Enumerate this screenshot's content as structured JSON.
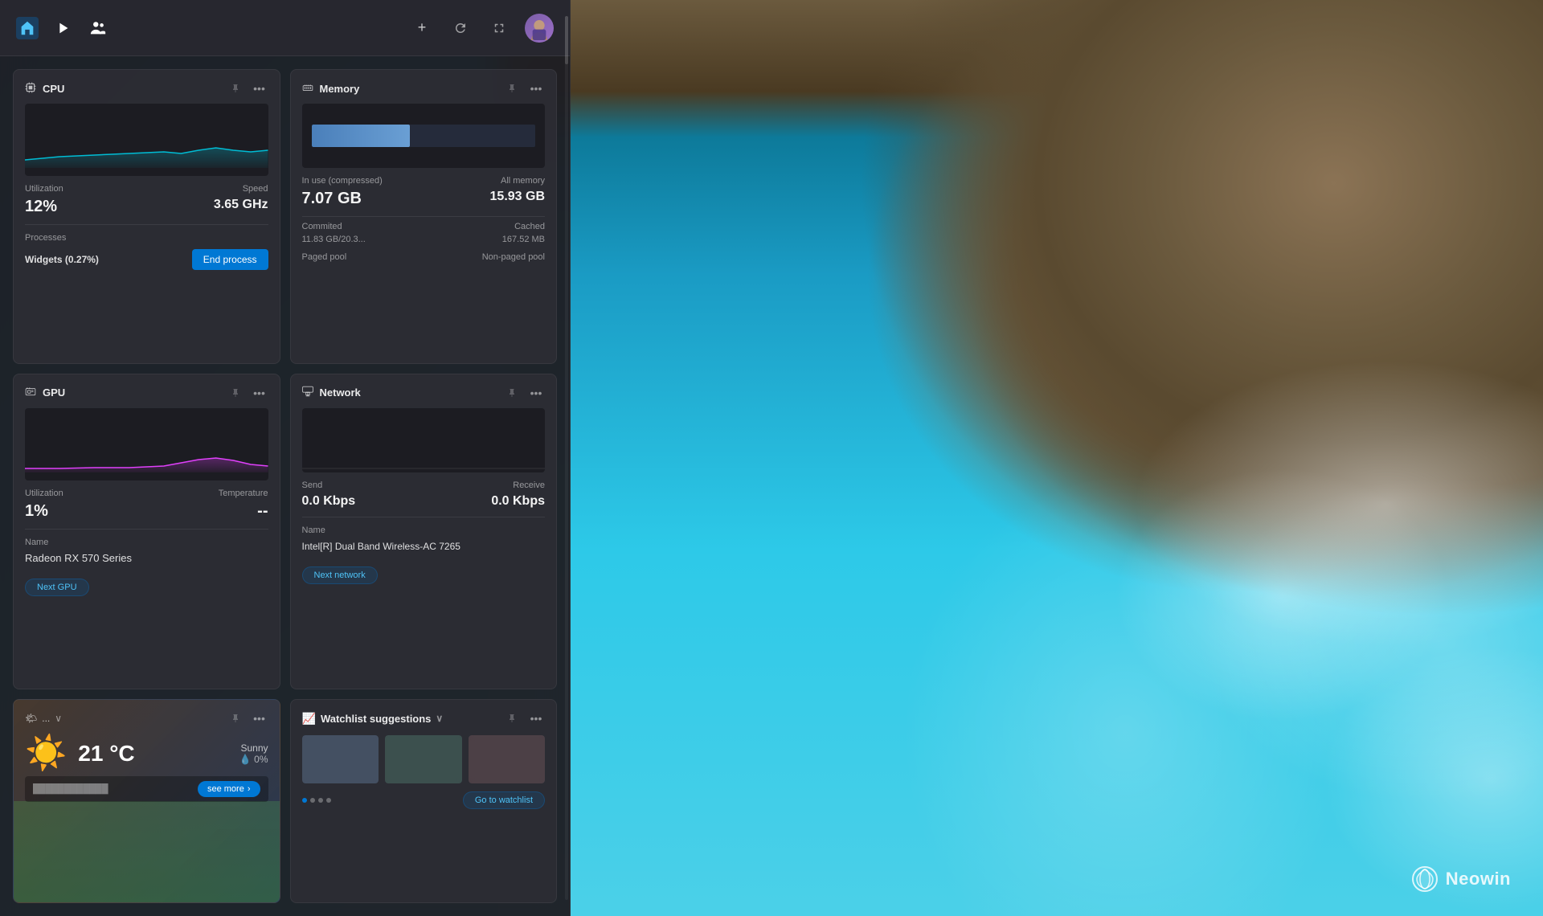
{
  "background": {
    "colors": {
      "ocean_start": "#1a6b8a",
      "ocean_end": "#4bd0e8"
    }
  },
  "neowin": {
    "label": "Neowin"
  },
  "header": {
    "nav_icons": [
      {
        "id": "home",
        "symbol": "⊞",
        "active": true
      },
      {
        "id": "media",
        "symbol": "▶"
      },
      {
        "id": "people",
        "symbol": "👤"
      }
    ],
    "actions": [
      {
        "id": "add",
        "symbol": "+"
      },
      {
        "id": "refresh",
        "symbol": "↻"
      },
      {
        "id": "expand",
        "symbol": "⤢"
      }
    ]
  },
  "cpu_card": {
    "title": "CPU",
    "utilization_label": "Utilization",
    "speed_label": "Speed",
    "utilization_value": "12%",
    "speed_value": "3.65 GHz",
    "processes_label": "Processes",
    "process_name": "Widgets (0.27%)",
    "end_process_label": "End process",
    "pin_symbol": "📌",
    "more_symbol": "…"
  },
  "memory_card": {
    "title": "Memory",
    "in_use_label": "In use (compressed)",
    "all_memory_label": "All memory",
    "in_use_value": "7.07 GB",
    "all_memory_value": "15.93 GB",
    "committed_label": "Commited",
    "cached_label": "Cached",
    "committed_value": "11.83 GB/20.3...",
    "cached_value": "167.52 MB",
    "paged_pool_label": "Paged pool",
    "non_paged_pool_label": "Non-paged pool",
    "bar_fill_percent": 44,
    "pin_symbol": "📌",
    "more_symbol": "…"
  },
  "gpu_card": {
    "title": "GPU",
    "utilization_label": "Utilization",
    "temperature_label": "Temperature",
    "utilization_value": "1%",
    "temperature_value": "--",
    "name_label": "Name",
    "name_value": "Radeon RX 570 Series",
    "next_label": "Next GPU",
    "pin_symbol": "📌",
    "more_symbol": "…"
  },
  "network_card": {
    "title": "Network",
    "send_label": "Send",
    "receive_label": "Receive",
    "send_value": "0.0 Kbps",
    "receive_value": "0.0 Kbps",
    "name_label": "Name",
    "name_value": "Intel[R] Dual Band Wireless-AC 7265",
    "next_label": "Next network",
    "pin_symbol": "📌",
    "more_symbol": "…"
  },
  "weather_card": {
    "location": "...",
    "chevron": "∨",
    "temperature": "21 °C",
    "condition": "Sunny",
    "rain_percent": "0%",
    "sun_icon": "☀",
    "see_more_label": "see more",
    "see_more_arrow": "›"
  },
  "watchlist_card": {
    "title": "Watchlist suggestions",
    "chevron": "∨",
    "goto_label": "Go to watchlist",
    "dots": [
      true,
      false,
      false,
      false
    ],
    "pin_symbol": "📌",
    "more_symbol": "…"
  }
}
